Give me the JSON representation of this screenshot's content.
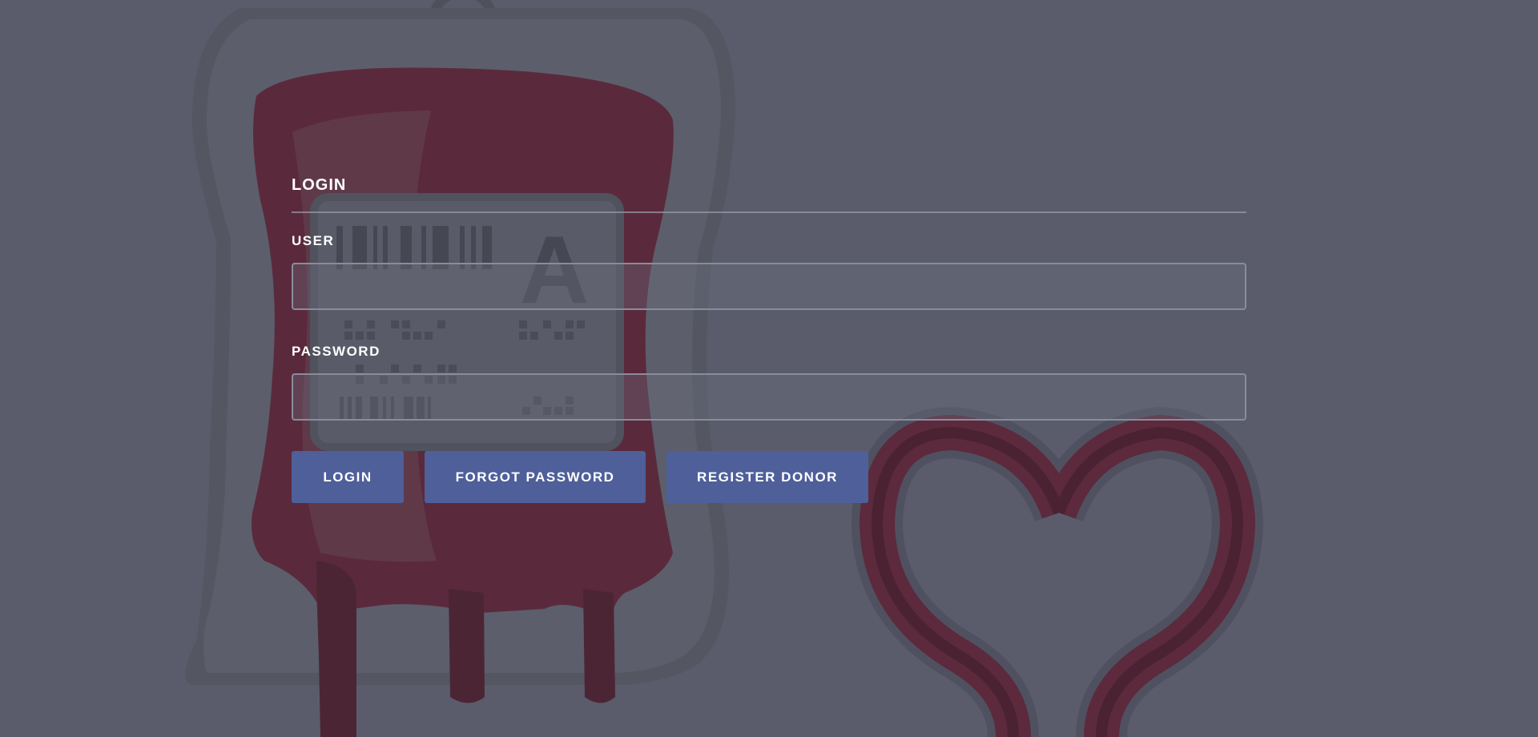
{
  "form": {
    "title": "LOGIN",
    "user_label": "USER",
    "user_value": "",
    "password_label": "PASSWORD",
    "password_value": ""
  },
  "buttons": {
    "login": "LOGIN",
    "forgot_password": "FORGOT PASSWORD",
    "register_donor": "REGISTER DONOR"
  },
  "background": {
    "blood_type_label": "A",
    "icons": [
      "blood-bag-icon",
      "heart-tube-icon"
    ]
  },
  "colors": {
    "background": "#5a5c6b",
    "button": "#4e5f9a",
    "blood": "#5e2b3d"
  }
}
